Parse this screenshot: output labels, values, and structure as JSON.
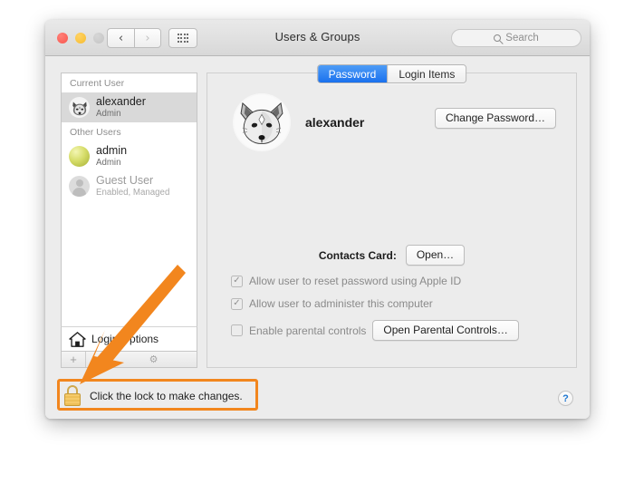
{
  "window": {
    "title": "Users & Groups",
    "traffic_lights": [
      "close-red",
      "minimize-yellow",
      "zoom-gray-disabled"
    ],
    "nav": {
      "back": "‹",
      "forward": "›",
      "grid": "show-all-grid"
    },
    "search": {
      "placeholder": "Search",
      "value": "",
      "icon": "search-icon"
    }
  },
  "sidebar": {
    "groups": [
      {
        "header": "Current User",
        "users": [
          {
            "name": "alexander",
            "role": "Admin",
            "avatar": "fox-avatar",
            "selected": true,
            "dim": false
          }
        ]
      },
      {
        "header": "Other Users",
        "users": [
          {
            "name": "admin",
            "role": "Admin",
            "avatar": "ball-avatar",
            "selected": false,
            "dim": false
          },
          {
            "name": "Guest User",
            "role": "Enabled, Managed",
            "avatar": "person-silhouette-avatar",
            "selected": false,
            "dim": true
          }
        ]
      }
    ],
    "login_options": {
      "label": "Login Options",
      "icon": "home-icon"
    },
    "buttons": {
      "add": "+",
      "remove": "−",
      "gear": "⚙"
    }
  },
  "content": {
    "tabs": [
      {
        "label": "Password",
        "active": true
      },
      {
        "label": "Login Items",
        "active": false
      }
    ],
    "user": {
      "name": "alexander",
      "avatar": "fox-avatar"
    },
    "change_password_button": "Change Password…",
    "contacts_card": {
      "label": "Contacts Card:",
      "button": "Open…"
    },
    "checkboxes": [
      {
        "label": "Allow user to reset password using Apple ID",
        "checked": true,
        "mark": "✓",
        "disabled": true
      },
      {
        "label": "Allow user to administer this computer",
        "checked": true,
        "mark": "✓",
        "disabled": true
      },
      {
        "label": "Enable parental controls",
        "checked": false,
        "mark": "",
        "disabled": true
      }
    ],
    "parental_controls_button": "Open Parental Controls…",
    "help_button": "?"
  },
  "lock": {
    "text": "Click the lock to make changes.",
    "icon": "closed-padlock-icon",
    "state": "locked"
  },
  "annotation": {
    "highlight_color": "#f2861e",
    "arrow": "orange-arrow-pointing-to-lock",
    "box_target": "lock-row"
  }
}
